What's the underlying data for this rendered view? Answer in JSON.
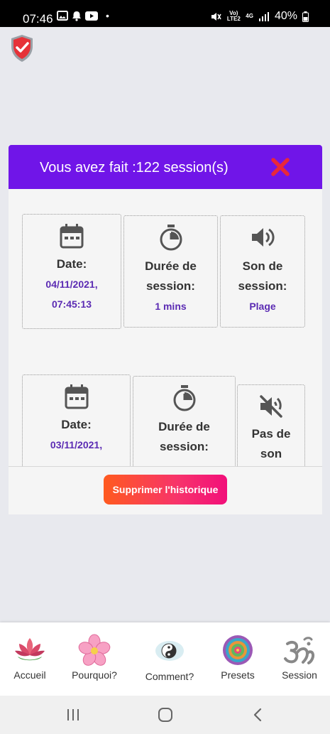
{
  "status_bar": {
    "time": "07:46",
    "network": "Vo) LTE2",
    "network_type": "4G",
    "battery": "40%"
  },
  "dialog": {
    "title": "Vous avez fait :122 session(s)",
    "accent_color": "#7015e8",
    "sessions": [
      {
        "date_label": "Date:",
        "date_value_line1": "04/11/2021,",
        "date_value_line2": "07:45:13",
        "duration_label_line1": "Durée de",
        "duration_label_line2": "session:",
        "duration_value": "1 mins",
        "sound_label_line1": "Son de",
        "sound_label_line2": "session:",
        "sound_value": "Plage",
        "sound_icon": "volume-icon"
      },
      {
        "date_label": "Date:",
        "date_value_line1": "03/11/2021,",
        "duration_label_line1": "Durée de",
        "duration_label_line2": "session:",
        "sound_label_line1": "Pas de",
        "sound_label_line2": "son",
        "sound_icon": "volume-mute-icon"
      }
    ],
    "clear_button": "Supprimer l'historique"
  },
  "bottom_nav": [
    {
      "label": "Accueil",
      "icon": "lotus-icon"
    },
    {
      "label": "Pourquoi?",
      "icon": "flower-icon"
    },
    {
      "label": "Comment?",
      "icon": "yin-yang-icon"
    },
    {
      "label": "Presets",
      "icon": "mandala-icon"
    },
    {
      "label": "Session",
      "icon": "om-icon"
    }
  ]
}
